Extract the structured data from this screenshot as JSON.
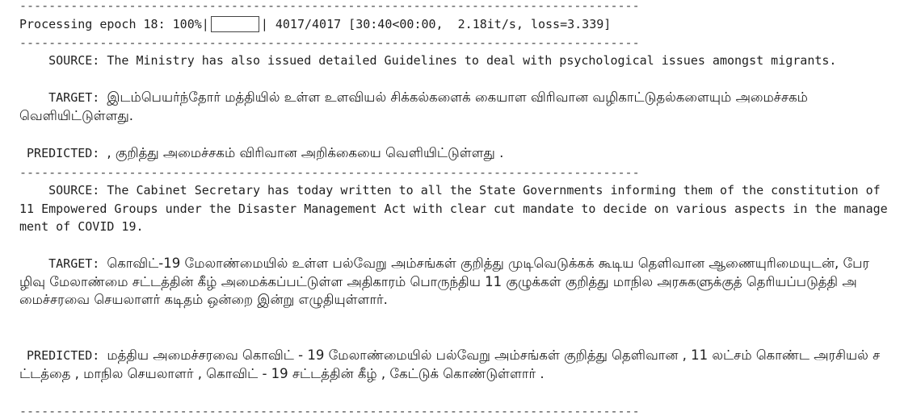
{
  "separator": "-----------------------------------------------------------------------------------------------------------------",
  "progress": {
    "prefix": "Processing epoch 18: 100%|",
    "suffix": "| 4017/4017 [30:40<00:00,  2.18it/s, loss=3.339]",
    "percent": 100
  },
  "examples": [
    {
      "source_label": "    SOURCE: ",
      "source": "The Ministry has also issued detailed Guidelines to deal with psychological issues amongst migrants.",
      "target_label": "    TARGET: ",
      "target": "இடம்பெயர்ந்தோர் மத்தியில் உள்ள உளவியல் சிக்கல்களைக் கையாள விரிவான வழிகாட்டுதல்களையும் அமைச்சகம் வெளியிட்டுள்ளது.",
      "predicted_label": " PREDICTED: ",
      "predicted": ", குறித்து அமைச்சகம் விரிவான அறிக்கையை வெளியிட்டுள்ளது ."
    },
    {
      "source_label": "    SOURCE: ",
      "source": "The Cabinet Secretary has today written to all the State Governments informing them of the constitution of 11 Empowered Groups under the Disaster Management Act with clear cut mandate to decide on various aspects in the management of COVID 19.",
      "target_label": "    TARGET: ",
      "target": "கொவிட்-19 மேலாண்மையில் உள்ள பல்வேறு அம்சங்கள் குறித்து முடிவெடுக்கக் கூடிய தெளிவான ஆணையுரிமையுடன், பேரழிவு மேலாண்மை சட்டத்தின் கீழ் அமைக்கப்பட்டுள்ள அதிகாரம் பொருந்திய 11 குழுக்கள் குறித்து மாநில அரசுகளுக்குத் தெரியப்படுத்தி அமைச்சரவை செயலாளர் கடிதம் ஒன்றை இன்று எழுதியுள்ளார்.",
      "predicted_label": " PREDICTED: ",
      "predicted": "மத்திய அமைச்சரவை கொவிட் - 19 மேலாண்மையில் பல்வேறு அம்சங்கள் குறித்து தெளிவான , 11 லட்சம் கொண்ட அரசியல் சட்டத்தை , மாநில செயலாளர் , கொவிட் - 19 சட்டத்தின் கீழ் , கேட்டுக் கொண்டுள்ளார் ."
    }
  ]
}
